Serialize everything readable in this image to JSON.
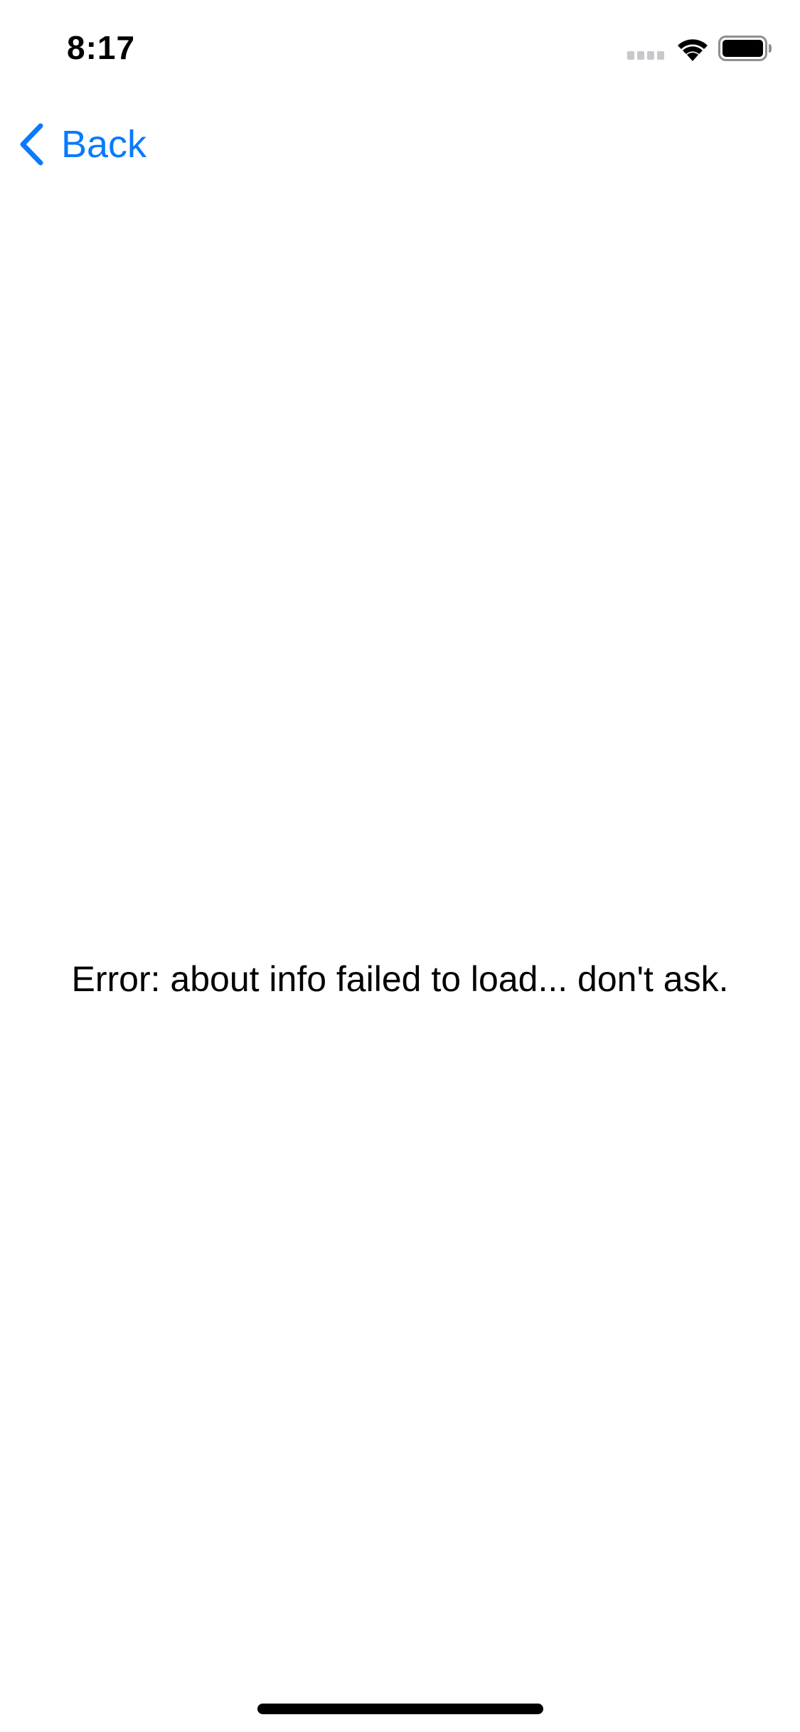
{
  "status_bar": {
    "time": "8:17",
    "signal_icon": "cellular-signal-icon",
    "wifi_icon": "wifi-icon",
    "battery_icon": "battery-icon"
  },
  "nav": {
    "back_label": "Back",
    "back_icon": "chevron-left-icon",
    "accent_color": "#0a7aff"
  },
  "main": {
    "message": "Error: about info failed to load... don't ask."
  }
}
